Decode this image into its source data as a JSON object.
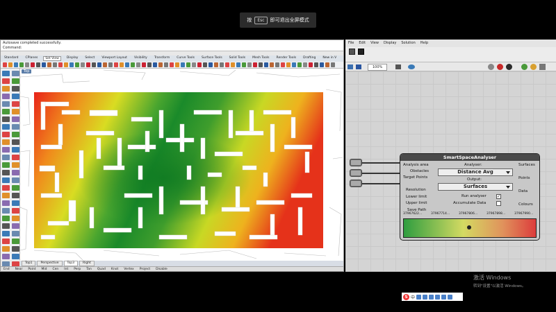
{
  "toast": {
    "prefix": "按",
    "key": "Esc",
    "suffix": "即可退出全屏模式"
  },
  "rhino": {
    "command_line": "Autosave completed successfully.",
    "command_prompt": "Command:",
    "tabs": [
      "Standard",
      "CPlanes",
      "Set View",
      "Display",
      "Select",
      "Viewport Layout",
      "Visibility",
      "Transform",
      "Curve Tools",
      "Surface Tools",
      "Solid Tools",
      "Mesh Tools",
      "Render Tools",
      "Drafting",
      "New in V"
    ],
    "active_tab": "Set View",
    "viewport_label": "Top",
    "viewport_tabs": [
      "Top1",
      "Perspective",
      "Top3",
      "Right"
    ],
    "active_viewport_tab": "Top3",
    "status": [
      "End",
      "Near",
      "Point",
      "Mid",
      "Cen",
      "Int",
      "Perp",
      "Tan",
      "Quad",
      "Knot",
      "Vertex",
      "Project",
      "Disable"
    ]
  },
  "gh": {
    "menu": [
      "File",
      "Edit",
      "View",
      "Display",
      "Solution",
      "Help"
    ],
    "zoom": "100%",
    "component": {
      "title": "SmartSpaceAnalyser",
      "inputs": [
        "Analysis area",
        "Obstacles",
        "Target Points",
        "Resolution",
        "Lower limit",
        "Upper limit",
        "Save Path"
      ],
      "outputs": [
        "Surfaces",
        "Points",
        "Data",
        "Colours"
      ],
      "analyser_label": "Analyser:",
      "analyser_value": "Distance Avg",
      "output_label": "Output:",
      "output_value": "Surfaces",
      "run_label": "Run analyser",
      "run_checked": true,
      "accumulate_label": "Accumulate Data",
      "accumulate_checked": false,
      "range_values": [
        "37967622...",
        "37967714...",
        "37967806...",
        "37967898...",
        "37967990..."
      ]
    }
  },
  "windows": {
    "line1": "激活 Windows",
    "line2": "转到\"设置\"以激活 Windows。"
  },
  "ime": {
    "mode": "中"
  },
  "colors": {
    "green": "#1e8c2c",
    "yellow": "#e6e020",
    "red": "#e01818"
  }
}
